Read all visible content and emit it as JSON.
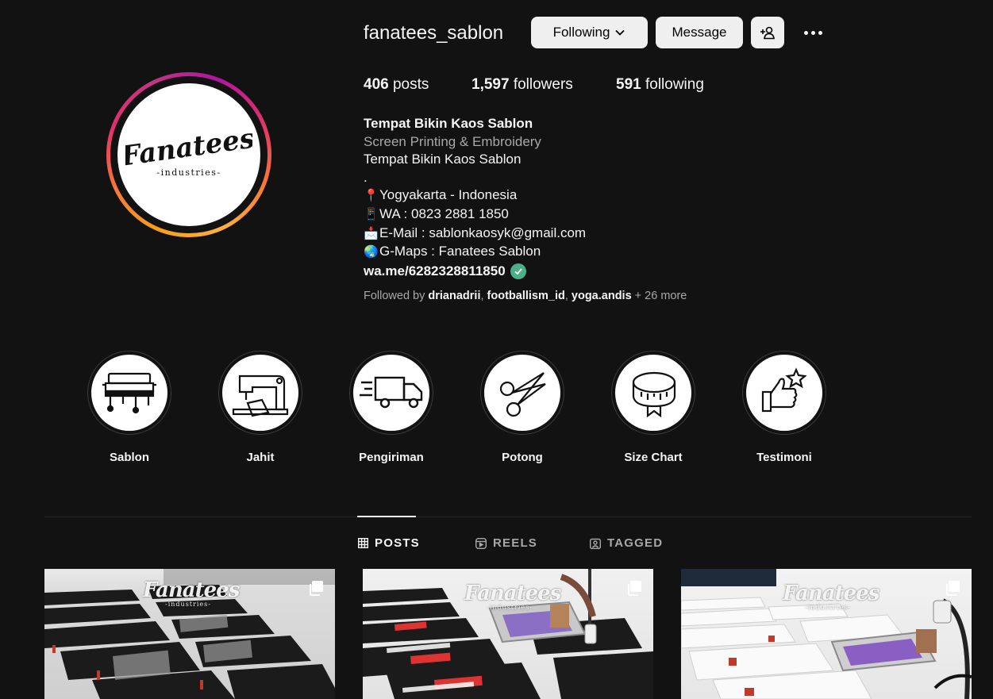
{
  "profile": {
    "username": "fanatees_sablon",
    "avatar_logo_text": "Fanatees",
    "avatar_logo_sub": "-industries-"
  },
  "actions": {
    "following_label": "Following",
    "message_label": "Message"
  },
  "stats": {
    "posts_count": "406",
    "posts_label": "posts",
    "followers_count": "1,597",
    "followers_label": "followers",
    "following_count": "591",
    "following_label": "following"
  },
  "bio": {
    "name": "Tempat Bikin Kaos Sablon",
    "category": "Screen Printing & Embroidery",
    "line1": "Tempat Bikin Kaos Sablon",
    "line2": ".",
    "location_emoji": "📍",
    "location": "Yogyakarta - Indonesia",
    "phone_emoji": "📱",
    "phone": "WA : 0823 2881 1850",
    "email_emoji": "📩",
    "email": "E-Mail : sablonkaosyk@gmail.com",
    "maps_emoji": "🌏",
    "maps": "G-Maps : Fanatees Sablon",
    "link": "wa.me/6282328811850"
  },
  "followed_by": {
    "prefix": "Followed by ",
    "user1": "drianadrii",
    "user2": "footballism_id",
    "user3": "yoga.andis",
    "more": " + 26 more",
    "sep": ", "
  },
  "highlights": [
    {
      "label": "Sablon",
      "icon": "screen-printing-press-icon"
    },
    {
      "label": "Jahit",
      "icon": "sewing-machine-icon"
    },
    {
      "label": "Pengiriman",
      "icon": "delivery-truck-icon"
    },
    {
      "label": "Potong",
      "icon": "scissors-icon"
    },
    {
      "label": "Size Chart",
      "icon": "measuring-tape-icon"
    },
    {
      "label": "Testimoni",
      "icon": "thumbs-up-star-icon"
    }
  ],
  "tabs": {
    "posts": "POSTS",
    "reels": "REELS",
    "tagged": "TAGGED"
  },
  "posts": [
    {
      "watermark": "Fanatees",
      "watermark_sub": "-industries-",
      "type": "carousel"
    },
    {
      "watermark": "Fanatees",
      "watermark_sub": "-industries-",
      "type": "carousel"
    },
    {
      "watermark": "Fanatees",
      "watermark_sub": "-industries-",
      "type": "carousel"
    }
  ],
  "colors": {
    "background": "#121212",
    "text": "#f5f5f5",
    "muted": "#a8a8a8",
    "button": "#efefef",
    "verified": "#4caf8a"
  }
}
